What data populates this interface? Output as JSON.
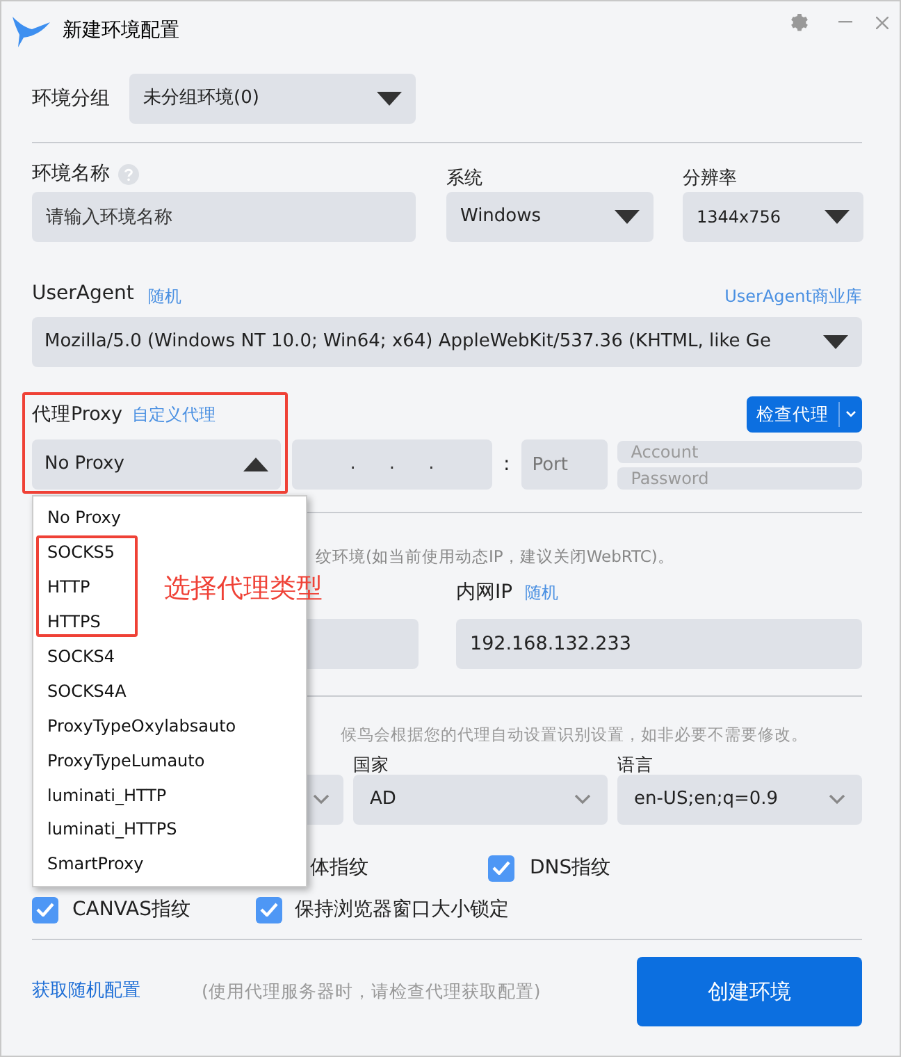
{
  "window": {
    "title": "新建环境配置"
  },
  "group": {
    "label": "环境分组",
    "value": "未分组环境(0)"
  },
  "name": {
    "label": "环境名称",
    "placeholder": "请输入环境名称"
  },
  "system": {
    "label": "系统",
    "value": "Windows"
  },
  "resolution": {
    "label": "分辨率",
    "value": "1344x756"
  },
  "user_agent": {
    "label": "UserAgent",
    "random_link": "随机",
    "library_link": "UserAgent商业库",
    "value": "Mozilla/5.0 (Windows NT 10.0; Win64; x64) AppleWebKit/537.36 (KHTML, like Ge"
  },
  "proxy": {
    "label": "代理Proxy",
    "custom_link": "自定义代理",
    "check_button": "检查代理",
    "type": {
      "value": "No Proxy",
      "expanded": true
    },
    "ip_separators": [
      ".",
      ".",
      "."
    ],
    "colon": ":",
    "port_placeholder": "Port",
    "account_placeholder": "Account",
    "password_placeholder": "Password",
    "options": [
      {
        "label": "No Proxy"
      },
      {
        "label": "SOCKS5"
      },
      {
        "label": "HTTP"
      },
      {
        "label": "HTTPS"
      },
      {
        "label": "SOCKS4"
      },
      {
        "label": "SOCKS4A"
      },
      {
        "label": "ProxyTypeOxylabsauto"
      },
      {
        "label": "ProxyTypeLumauto"
      },
      {
        "label": "luminati_HTTP"
      },
      {
        "label": "luminati_HTTPS"
      },
      {
        "label": "SmartProxy"
      }
    ]
  },
  "webrtc_note": "纹环境(如当前使用动态IP，建议关闭WebRTC)。",
  "lan_ip": {
    "label": "内网IP",
    "random_link": "随机",
    "value": "192.168.132.233"
  },
  "auto_hint": "候鸟会根据您的代理自动设置识别设置，如非必要不需要修改。",
  "country": {
    "label": "国家",
    "value": "AD"
  },
  "language": {
    "label": "语言",
    "value": "en-US;en;q=0.9"
  },
  "font_fingerprint_partial": "体指纹",
  "checkboxes": [
    {
      "label": "DNS指纹",
      "checked": true
    },
    {
      "label": "CANVAS指纹",
      "checked": true
    },
    {
      "label": "保持浏览器窗口大小锁定",
      "checked": true
    }
  ],
  "footer": {
    "random_link": "获取随机配置",
    "note": "(使用代理服务器时，请检查代理获取配置)",
    "create_button": "创建环境"
  },
  "annotation": {
    "text": "选择代理类型"
  }
}
